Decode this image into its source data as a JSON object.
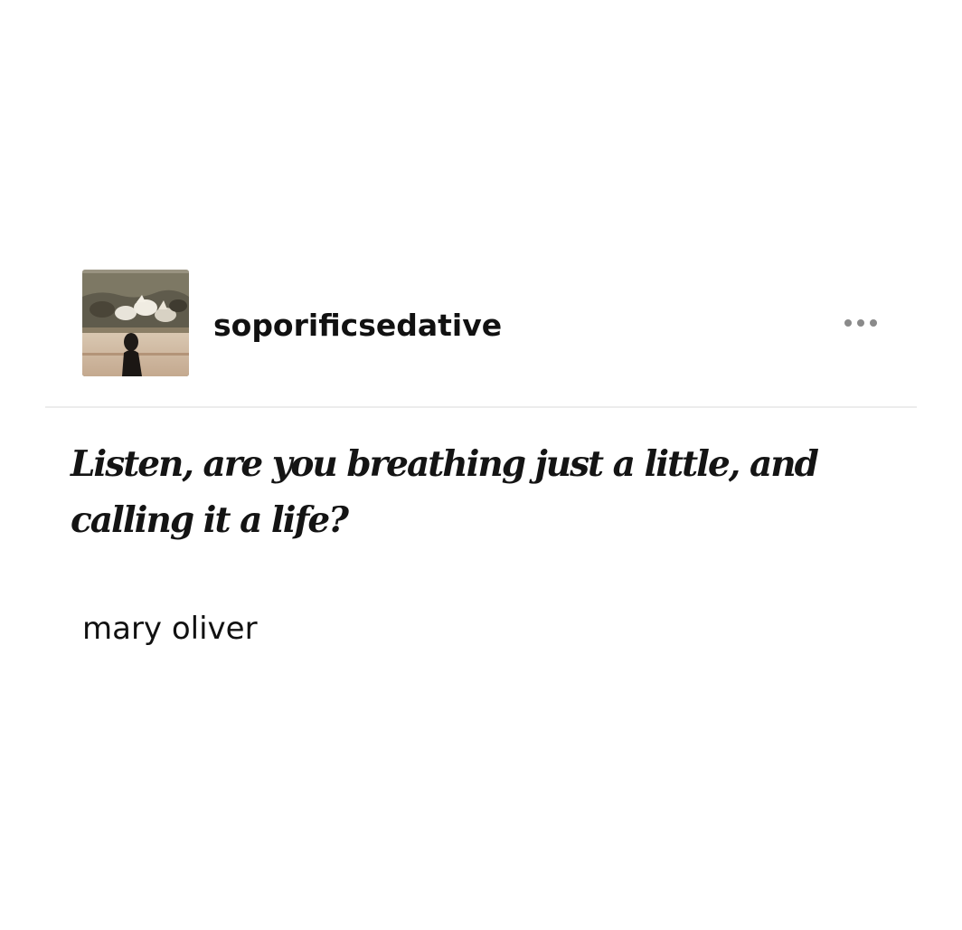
{
  "post": {
    "username": "soporificsedative",
    "more_icon": "ellipsis-icon",
    "quote": "Listen, are you breathing just a little, and calling it a life?",
    "attribution": "mary oliver"
  },
  "colors": {
    "background": "#ffffff",
    "text": "#111111",
    "divider": "#ececec",
    "icon": "#8a8a8a"
  }
}
